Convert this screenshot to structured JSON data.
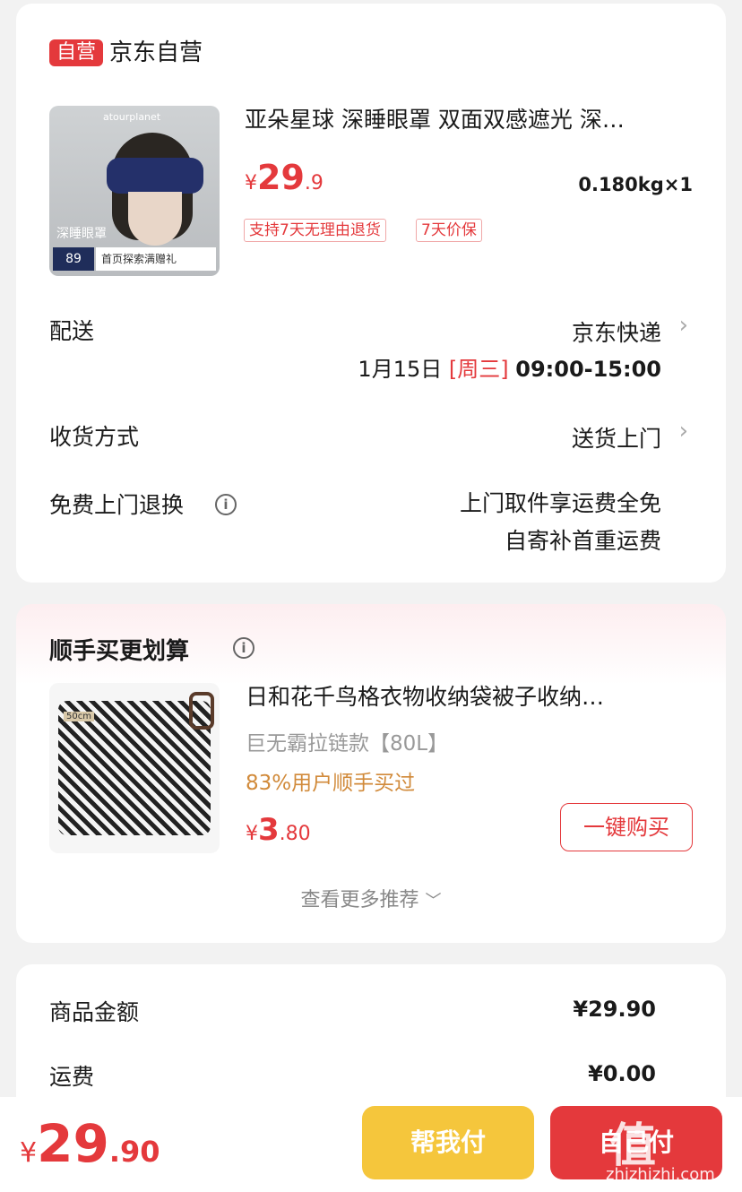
{
  "store": {
    "badge": "自营",
    "name": "京东自营"
  },
  "product": {
    "title": "亚朵星球 深睡眼罩 双面双感遮光 深…",
    "price_symbol": "¥",
    "price_int": "29",
    "price_dec": ".9",
    "weight_qty": "0.180kg×1",
    "tags": [
      "支持7天无理由退货",
      "7天价保"
    ],
    "image_text": {
      "brand": "atourplanet",
      "label": "深睡眼罩",
      "price": "89",
      "promo": "首页探索满赠礼"
    }
  },
  "delivery": {
    "label": "配送",
    "carrier": "京东快递",
    "date": "1月15日",
    "weekday": "[周三]",
    "time": "09:00-15:00"
  },
  "receive": {
    "label": "收货方式",
    "value": "送货上门"
  },
  "free_return": {
    "label": "免费上门退换",
    "line1": "上门取件享运费全免",
    "line2": "自寄补首重运费"
  },
  "recommend": {
    "title": "顺手买更划算",
    "item": {
      "title": "日和花千鸟格衣物收纳袋被子收纳…",
      "variant": "巨无霸拉链款【80L】",
      "stat": "83%用户顺手买过",
      "price_symbol": "¥",
      "price_int": "3",
      "price_dec": ".80",
      "size_label": "50cm"
    },
    "buy_label": "一键购买",
    "more_label": "查看更多推荐"
  },
  "summary": {
    "goods_label": "商品金额",
    "goods_value": "¥29.90",
    "shipping_label": "运费",
    "shipping_value": "¥0.00"
  },
  "bottom": {
    "total_symbol": "¥",
    "total_int": "29",
    "total_dec": ".90",
    "help_pay_label": "帮我付",
    "pay_label": "自己付"
  },
  "watermark": {
    "main": "值",
    "sub": "zhizhizhi.com"
  },
  "colors": {
    "accent": "#e4393c",
    "recommend_stat": "#d18a3a",
    "help_pay_bg": "#f5c63c",
    "pay_bg": "#e4393c"
  }
}
